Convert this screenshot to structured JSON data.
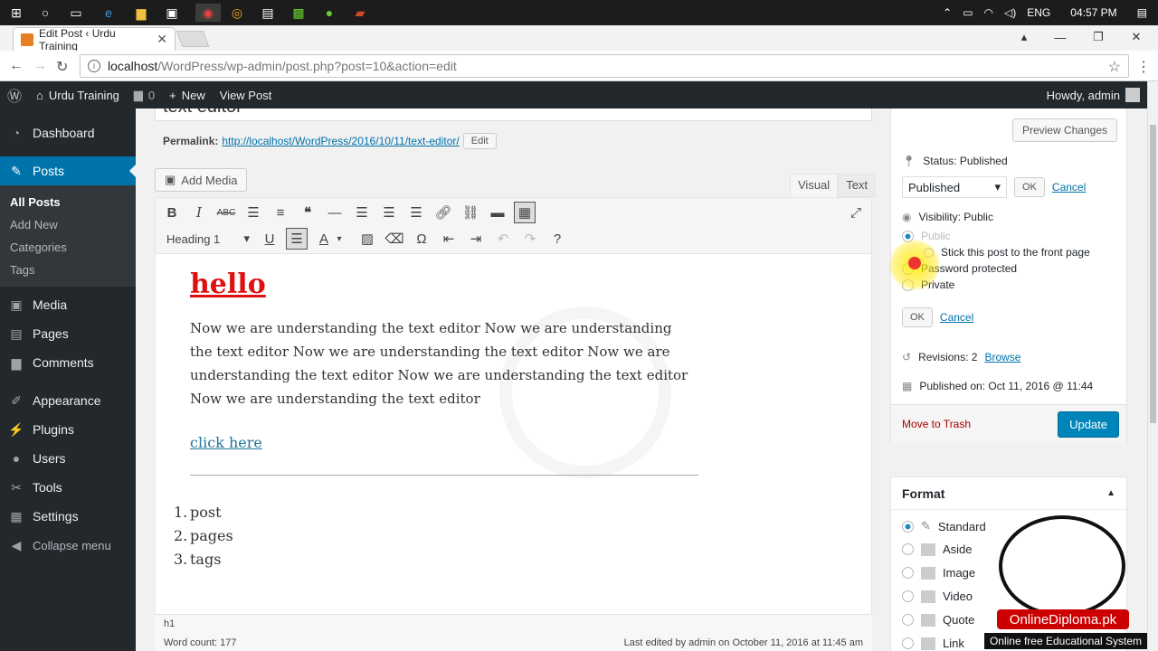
{
  "taskbar": {
    "language": "ENG",
    "time": "04:57 PM"
  },
  "browser": {
    "tab_title": "Edit Post ‹ Urdu Training",
    "url_host": "localhost",
    "url_path": "/WordPress/wp-admin/post.php?post=10&action=edit"
  },
  "adminbar": {
    "site": "Urdu Training",
    "comments": "0",
    "new": "New",
    "view": "View Post",
    "howdy": "Howdy, admin"
  },
  "sidebar": {
    "items": [
      {
        "label": "Dashboard",
        "icon": "dashboard-icon"
      },
      {
        "label": "Posts",
        "icon": "pin-icon"
      }
    ],
    "sub": [
      "All Posts",
      "Add New",
      "Categories",
      "Tags"
    ],
    "items2": [
      {
        "label": "Media",
        "icon": "media-icon"
      },
      {
        "label": "Pages",
        "icon": "pages-icon"
      },
      {
        "label": "Comments",
        "icon": "comments-icon"
      },
      {
        "label": "Appearance",
        "icon": "brush-icon"
      },
      {
        "label": "Plugins",
        "icon": "plugin-icon"
      },
      {
        "label": "Users",
        "icon": "users-icon"
      },
      {
        "label": "Tools",
        "icon": "wrench-icon"
      },
      {
        "label": "Settings",
        "icon": "settings-icon"
      },
      {
        "label": "Collapse menu",
        "icon": "collapse-icon"
      }
    ]
  },
  "post": {
    "title": "text editor",
    "permalink_label": "Permalink:",
    "permalink": "http://localhost/WordPress/2016/10/11/text-editor/",
    "edit": "Edit",
    "add_media": "Add Media",
    "tab_visual": "Visual",
    "tab_text": "Text",
    "format": "Heading 1",
    "heading": "hello",
    "paragraph": "Now we are understanding the text editor Now we are understanding the text editor Now we are understanding the text editor Now we are understanding the text editor Now we are understanding the text editor Now we are understanding the text editor",
    "link": "click here",
    "list": [
      "post",
      "pages",
      "tags"
    ],
    "path": "h1",
    "word_count": "Word count: 177",
    "last_edited": "Last edited by admin on October 11, 2016 at 11:45 am"
  },
  "publish": {
    "preview": "Preview Changes",
    "status": "Status: Published",
    "status_select": "Published",
    "ok": "OK",
    "cancel": "Cancel",
    "visibility": "Visibility: Public",
    "opt_public": "Public",
    "opt_sticky": "Stick this post to the front page",
    "opt_password": "Password protected",
    "opt_private": "Private",
    "revisions": "Revisions: 2",
    "browse": "Browse",
    "published_on": "Published on: Oct 11, 2016 @ 11:44",
    "trash": "Move to Trash",
    "update": "Update"
  },
  "format_box": {
    "title": "Format",
    "options": [
      "Standard",
      "Aside",
      "Image",
      "Video",
      "Quote",
      "Link"
    ]
  },
  "watermark": {
    "brand": "OnlineDiploma.pk",
    "tagline": "Online free Educational System"
  },
  "colors": {
    "accent": "#0073aa",
    "sidebar": "#23282d",
    "update": "#0085ba",
    "heading": "#dd1111"
  }
}
